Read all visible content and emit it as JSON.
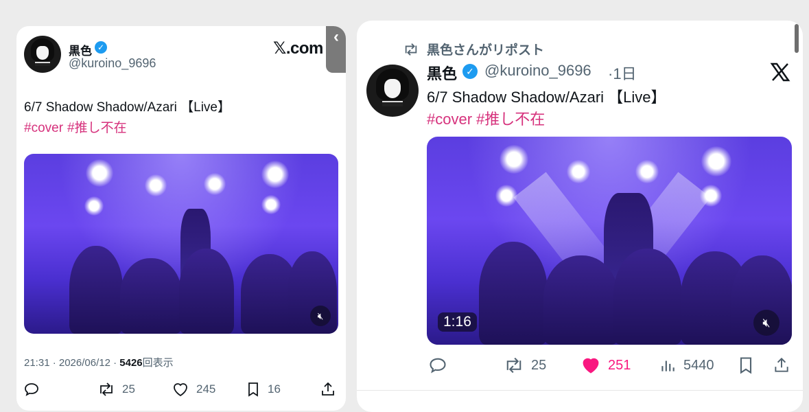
{
  "left_tweet": {
    "name": "黒色",
    "handle": "@kuroino_9696",
    "brand": "𝕏.com",
    "text": "6/7 Shadow Shadow/Azari 【Live】",
    "hashtags": [
      "#cover",
      "#推し不在"
    ],
    "timestamp": "21:31 · 2026/06/12 · ",
    "views_count": "5426",
    "views_label": "回表示",
    "stats": {
      "retweets": "25",
      "likes": "245",
      "bookmarks": "16"
    },
    "icons": [
      "reply-icon",
      "retweet-icon",
      "like-icon",
      "bookmark-icon",
      "share-icon",
      "mute-icon",
      "chevron-left-icon"
    ]
  },
  "right_tweet": {
    "repost_label": "黒色さんがリポスト",
    "name": "黒色",
    "handle": "@kuroino_9696",
    "time_ago": "·1日",
    "text": "6/7 Shadow Shadow/Azari 【Live】",
    "hashtags": [
      "#cover",
      "#推し不在"
    ],
    "video_time": "1:16",
    "stats": {
      "retweets": "25",
      "likes": "251",
      "views": "5440"
    },
    "icons": [
      "repost-icon",
      "x-logo-icon",
      "reply-icon",
      "retweet-icon",
      "like-icon",
      "views-icon",
      "bookmark-icon",
      "share-icon",
      "mute-icon"
    ]
  },
  "colors": {
    "hashtag": "#d6317c",
    "verified": "#1d9bf0",
    "like_active": "#f91880",
    "secondary_text": "#536471",
    "stage": "#5b3ee0"
  }
}
